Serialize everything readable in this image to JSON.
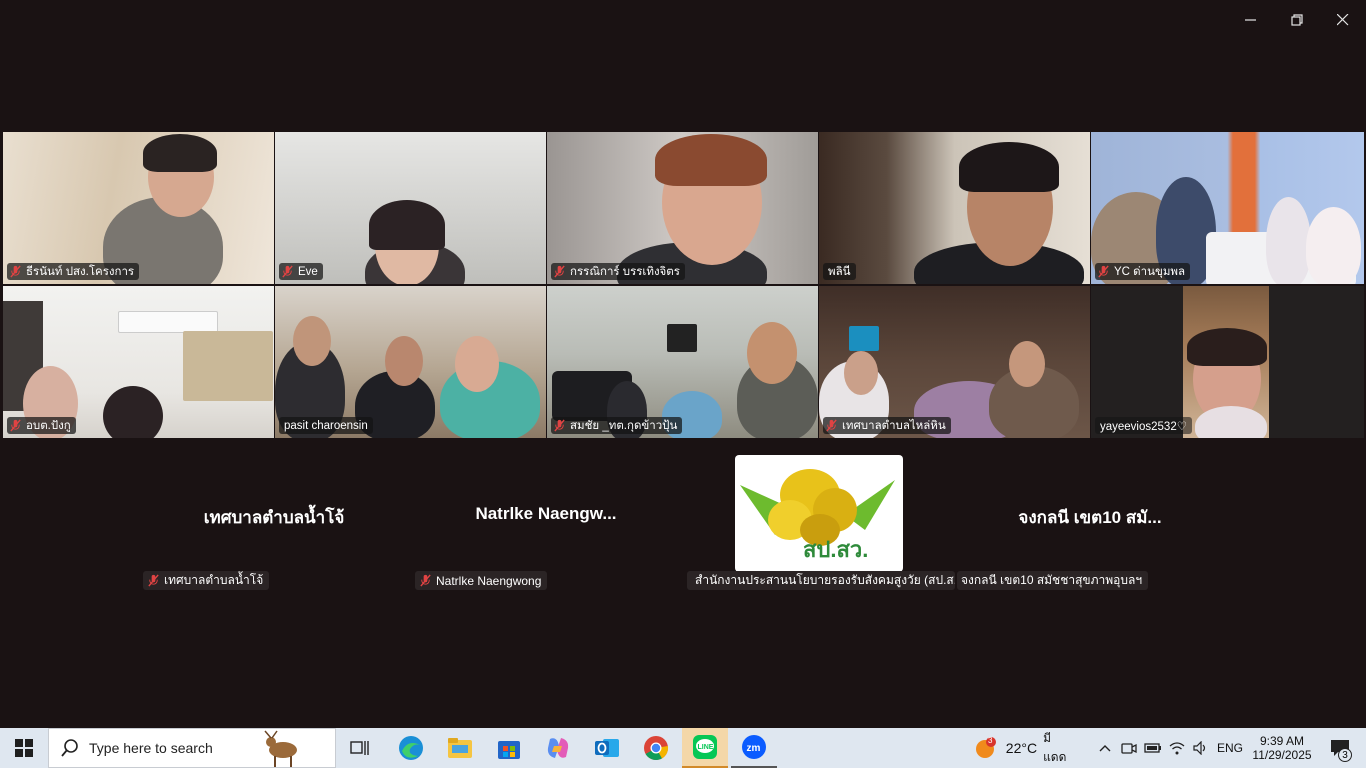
{
  "window": {
    "minimize": "minimize",
    "restore": "restore",
    "close": "close"
  },
  "tiles": [
    {
      "name": "ธีรนันท์ ปสง.โครงการ",
      "muted": true
    },
    {
      "name": "Eve",
      "muted": true
    },
    {
      "name": "กรรณิการ์ บรรเทิงจิตร",
      "muted": true
    },
    {
      "name": "พลินี",
      "muted": false,
      "active": true
    },
    {
      "name": "YC ด่านขุมพล",
      "muted": true
    },
    {
      "name": "อบต.ปังกู",
      "muted": true
    },
    {
      "name": "pasit charoensin",
      "muted": false
    },
    {
      "name": "สมชัย _ทต.กุดข้าวปุ้น",
      "muted": true
    },
    {
      "name": "เทศบาลตำบลไหล่หิน",
      "muted": true
    },
    {
      "name": "yayeevios2532♡",
      "muted": false
    }
  ],
  "audio_only": [
    {
      "display": "เทศบาลตำบลน้ำโจ้",
      "tag": "เทศบาลตำบลน้ำโจ้"
    },
    {
      "display": "Natrlke  Naengw...",
      "tag": "Natrlke Naengwong"
    },
    {
      "logo_text": "สป.สว.",
      "tag": "สำนักงานประสานนโยบายรองรับสังคมสูงวัย (สป.ส..."
    },
    {
      "display": "จงกลนี เขต10 สมั...",
      "tag": "จงกลนี เขต10 สมัชชาสุขภาพอุบลฯ"
    }
  ],
  "taskbar": {
    "search_placeholder": "Type here to search",
    "weather_temp": "22°C",
    "weather_desc": "มีแดด",
    "weather_badge": "3",
    "lang": "ENG",
    "time": "9:39 AM",
    "date": "11/29/2025",
    "notification_count": "3",
    "apps": [
      "task-view",
      "edge",
      "file-explorer",
      "store",
      "copilot",
      "outlook",
      "chrome",
      "line",
      "zoom"
    ]
  }
}
